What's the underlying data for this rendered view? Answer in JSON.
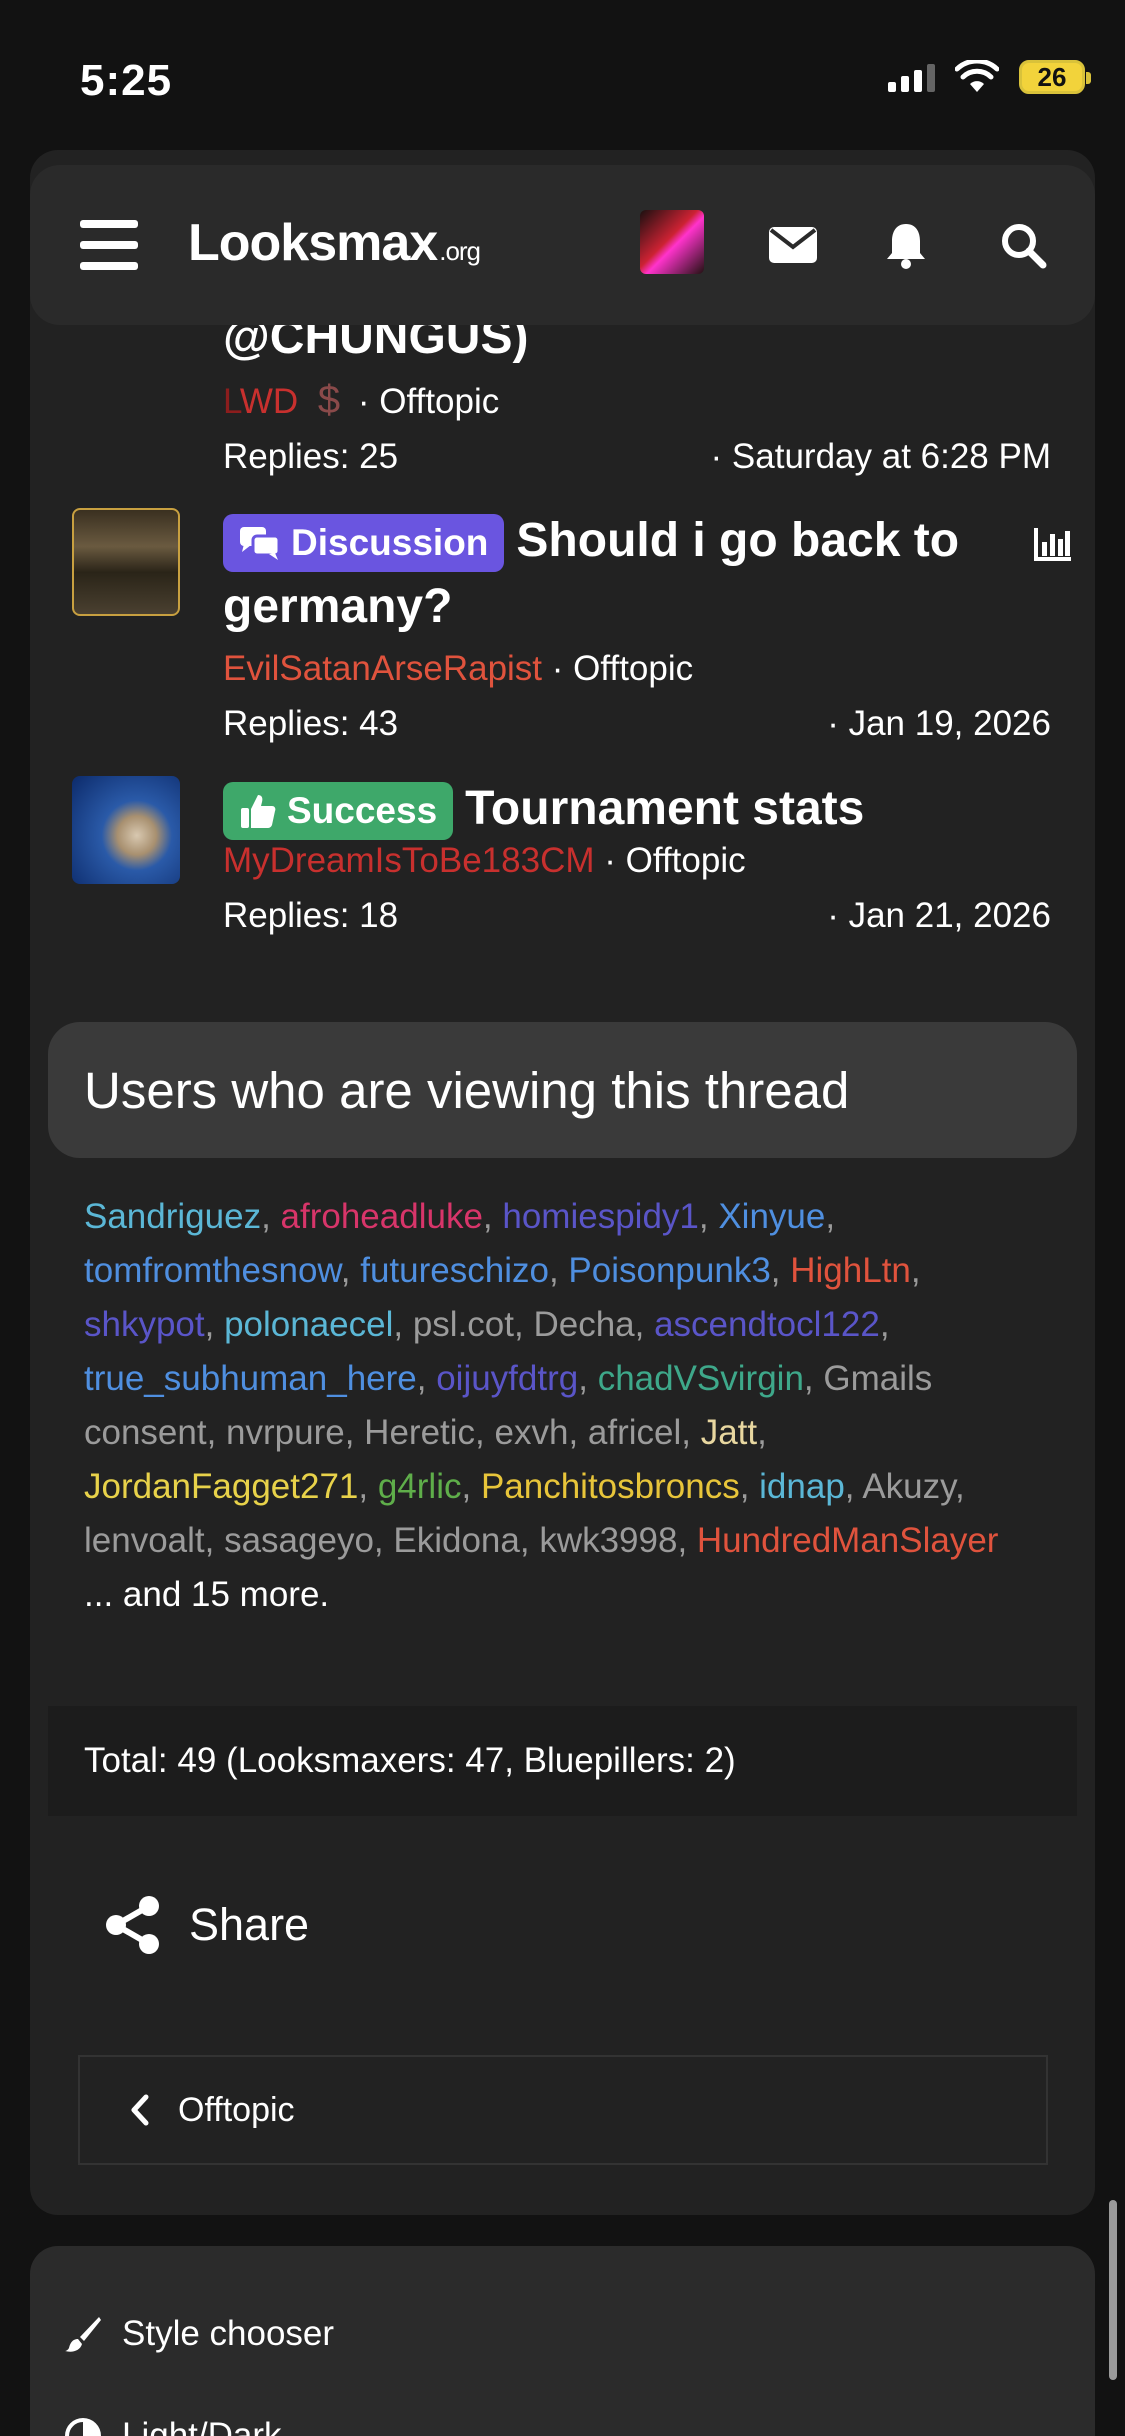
{
  "status_bar": {
    "time": "5:25",
    "battery": "26"
  },
  "header": {
    "logo_main": "Looksmax",
    "logo_suffix": ".org"
  },
  "threads": [
    {
      "title_tail": "@CHUNGUS)",
      "author_a": "L",
      "author_b": "WD",
      "dollar": "$",
      "forum": "Offtopic",
      "replies": "Replies: 25",
      "date": "Saturday at 6:28 PM"
    },
    {
      "badge": "Discussion",
      "badge_color": "#6a55e0",
      "title": "Should i go back to germany?",
      "author": "EvilSatanArseRapist",
      "author_color": "#e0533d",
      "forum": "Offtopic",
      "replies": "Replies: 43",
      "date": "Jan 19, 2026"
    },
    {
      "badge": "Success",
      "badge_color": "#3ea86a",
      "title": "Tournament stats",
      "author": "MyDreamIsToBe183CM",
      "author_color": "#c8302e",
      "forum": "Offtopic",
      "replies": "Replies: 18",
      "date": "Jan 21, 2026"
    }
  ],
  "viewers": {
    "heading": "Users who are viewing this thread",
    "users": [
      {
        "name": "Sandriguez",
        "color": "#5bb7d6"
      },
      {
        "name": "afroheadluke",
        "color": "#d8356a"
      },
      {
        "name": "homiespidy1",
        "color": "#5a55c8"
      },
      {
        "name": "Xinyue",
        "color": "#4f8fe0"
      },
      {
        "name": "tomfromthesnow",
        "color": "#4f8fe0"
      },
      {
        "name": "futureschizo",
        "color": "#4f8fe0"
      },
      {
        "name": "Poisonpunk3",
        "color": "#4f8fe0"
      },
      {
        "name": "HighLtn",
        "color": "#e0533d"
      },
      {
        "name": "shkypot",
        "color": "#5a55c8"
      },
      {
        "name": "polonaecel",
        "color": "#5bb7d6"
      },
      {
        "name": "psl.cot",
        "color": "#9b9b9b"
      },
      {
        "name": "Decha",
        "color": "#9b9b9b"
      },
      {
        "name": "ascendtocl122",
        "color": "#5a55c8"
      },
      {
        "name": "true_subhuman_here",
        "color": "#4f8fe0"
      },
      {
        "name": "oijuyfdtrg",
        "color": "#5a55c8"
      },
      {
        "name": "chadVSvirgin",
        "color": "#3ea88a"
      },
      {
        "name": "Gmails consent",
        "color": "#9b9b9b"
      },
      {
        "name": "nvrpure",
        "color": "#9b9b9b"
      },
      {
        "name": "Heretic",
        "color": "#9b9b9b"
      },
      {
        "name": "exvh",
        "color": "#9b9b9b"
      },
      {
        "name": "africel",
        "color": "#9b9b9b"
      },
      {
        "name": "Jatt",
        "color": "#e8d7a0"
      },
      {
        "name": "JordanFagget271",
        "color": "#e8d24a"
      },
      {
        "name": "g4rlic",
        "color": "#5fae4a"
      },
      {
        "name": "Panchitosbroncs",
        "color": "#e8c53a"
      },
      {
        "name": "idnap",
        "color": "#5bb7d6"
      },
      {
        "name": "Akuzy",
        "color": "#9b9b9b"
      },
      {
        "name": "lenvoalt",
        "color": "#9b9b9b"
      },
      {
        "name": "sasageyo",
        "color": "#9b9b9b"
      },
      {
        "name": "Ekidona",
        "color": "#9b9b9b"
      },
      {
        "name": "kwk3998",
        "color": "#9b9b9b"
      },
      {
        "name": "HundredManSlayer",
        "color": "#e0533d"
      }
    ],
    "more": "... and 15 more.",
    "total": "Total: 49 (Looksmaxers: 47, Bluepillers: 2)"
  },
  "share_label": "Share",
  "back_label": "Offtopic",
  "footer": {
    "style_chooser": "Style chooser",
    "light_dark": "Light/Dark"
  },
  "icons": {
    "menu": "hamburger-icon",
    "mail": "envelope-icon",
    "bell": "bell-icon",
    "search": "search-icon",
    "share": "share-icon",
    "back": "chevron-left-icon",
    "brush": "brush-icon"
  }
}
